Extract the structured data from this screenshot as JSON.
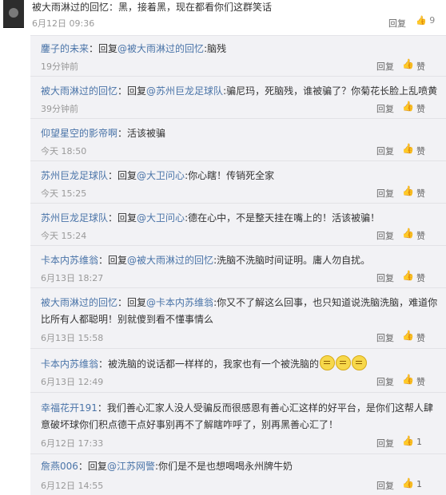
{
  "top": {
    "text": "被大雨淋过的回忆：黑，接着黑，现在都看你们这群笑话",
    "time": "6月12日 09:36",
    "reply": "回复",
    "like_icon": "thumb-up-icon",
    "like_count": "9"
  },
  "comments": [
    {
      "user": "鏖子的未来",
      "sep": "：",
      "reply_word": "回复",
      "mention": "@被大雨淋过的回忆",
      "text": ":脑残",
      "time": "19分钟前",
      "reply": "回复",
      "like": "赞"
    },
    {
      "user": "被大雨淋过的回忆",
      "sep": "：",
      "reply_word": "回复",
      "mention": "@苏州巨龙足球队",
      "text": ":骗尼玛，死脑残，谁被骗了？你菊花长脸上乱喷黄",
      "time": "39分钟前",
      "reply": "回复",
      "like": "赞"
    },
    {
      "user": "仰望星空的影帝啊",
      "sep": "：",
      "text": "活该被骗",
      "time": "今天 18:50",
      "reply": "回复",
      "like": "赞"
    },
    {
      "user": "苏州巨龙足球队",
      "sep": "：",
      "reply_word": "回复",
      "mention": "@大卫问心",
      "text": ":你心瞎！传销死全家",
      "time": "今天 15:25",
      "reply": "回复",
      "like": "赞"
    },
    {
      "user": "苏州巨龙足球队",
      "sep": "：",
      "reply_word": "回复",
      "mention": "@大卫问心",
      "text": ":德在心中，不是整天挂在嘴上的！活该被骗！",
      "time": "今天 15:24",
      "reply": "回复",
      "like": "赞"
    },
    {
      "user": "卡本内苏维翁",
      "sep": "：",
      "reply_word": "回复",
      "mention": "@被大雨淋过的回忆",
      "text": ":洗脑不洗脑时间证明。庸人勿自扰。",
      "time": "6月13日 18:27",
      "reply": "回复",
      "like": "赞"
    },
    {
      "user": "被大雨淋过的回忆",
      "sep": "：",
      "reply_word": "回复",
      "mention": "@卡本内苏维翁",
      "text": ":你又不了解这么回事，也只知道说洗脑洗脑，难道你",
      "text2": "比所有人都聪明！别就傻到看不懂事情么",
      "time": "6月13日 15:58",
      "reply": "回复",
      "like": "赞"
    },
    {
      "user": "卡本内苏维翁",
      "sep": "：",
      "text": "被洗脑的说话都一样样的，我家也有一个被洗脑的",
      "emoji": "sweat-face-icon",
      "time": "6月13日 12:49",
      "reply": "回复",
      "like": "赞"
    },
    {
      "user": "幸福花开191",
      "sep": "：",
      "text": "我们善心汇家人没人受骗反而很感恩有善心汇这样的好平台，是你们这帮人肆",
      "text2": "意破坏球你们积点德干点好事别再不了解瞎咋呼了，别再黑善心汇了！",
      "time": "6月12日 17:33",
      "reply": "回复",
      "like": "1"
    },
    {
      "user": "詹燕006",
      "sep": "：",
      "reply_word": "回复",
      "mention": "@江苏网警",
      "text": ":你们是不是也想喝喝永州牌牛奶",
      "time": "6月12日 14:55",
      "reply": "回复",
      "like": "1"
    }
  ]
}
